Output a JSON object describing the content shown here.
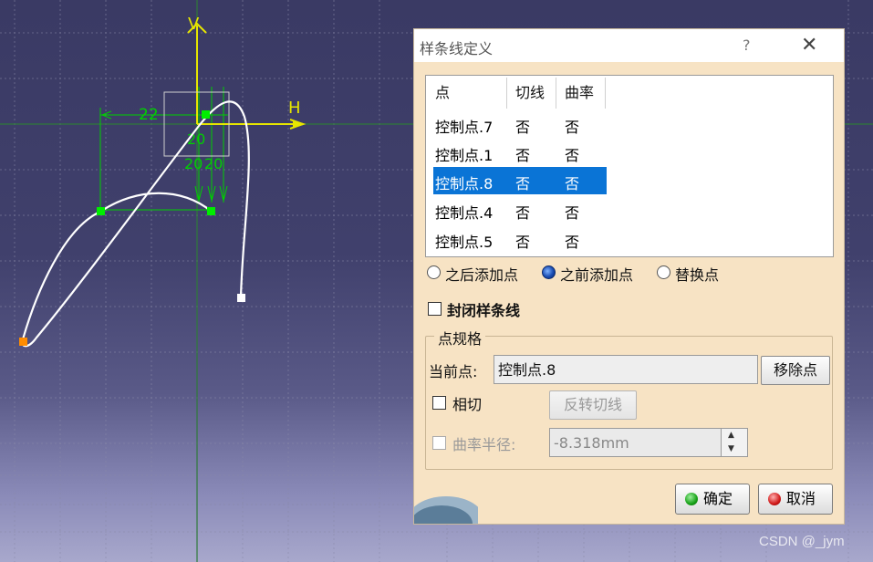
{
  "sketch": {
    "axis_v_label": "V",
    "axis_h_label": "H",
    "dim_22": "22",
    "dim_20_a": "20",
    "dim_20_b": "20",
    "dim_20_c": "20"
  },
  "dialog": {
    "title": "样条线定义",
    "help": "?",
    "close": "✕",
    "list": {
      "headers": [
        "点",
        "切线",
        "曲率"
      ],
      "rows": [
        {
          "name": "控制点.7",
          "tangent": "否",
          "curvature": "否",
          "selected": false
        },
        {
          "name": "控制点.1",
          "tangent": "否",
          "curvature": "否",
          "selected": false
        },
        {
          "name": "控制点.8",
          "tangent": "否",
          "curvature": "否",
          "selected": true
        },
        {
          "name": "控制点.4",
          "tangent": "否",
          "curvature": "否",
          "selected": false
        },
        {
          "name": "控制点.5",
          "tangent": "否",
          "curvature": "否",
          "selected": false
        }
      ]
    },
    "radios": {
      "after": "之后添加点",
      "before": "之前添加点",
      "replace": "替换点",
      "selected": "before"
    },
    "close_spline": "封闭样条线",
    "point_spec": {
      "legend": "点规格",
      "current_label": "当前点:",
      "current_value": "控制点.8",
      "remove_button": "移除点",
      "tangent_label": "相切",
      "reverse_button": "反转切线",
      "curvature_label": "曲率半径:",
      "curvature_value": "-8.318mm"
    },
    "ok": "确定",
    "cancel": "取消"
  },
  "watermark": "CSDN @_jym",
  "colors": {
    "background": "#40406c",
    "sketch_green": "#00d000",
    "axis_yellow": "#e6e600",
    "selection_blue": "#0a74d6",
    "dialog_bg": "#f7e3c4"
  }
}
